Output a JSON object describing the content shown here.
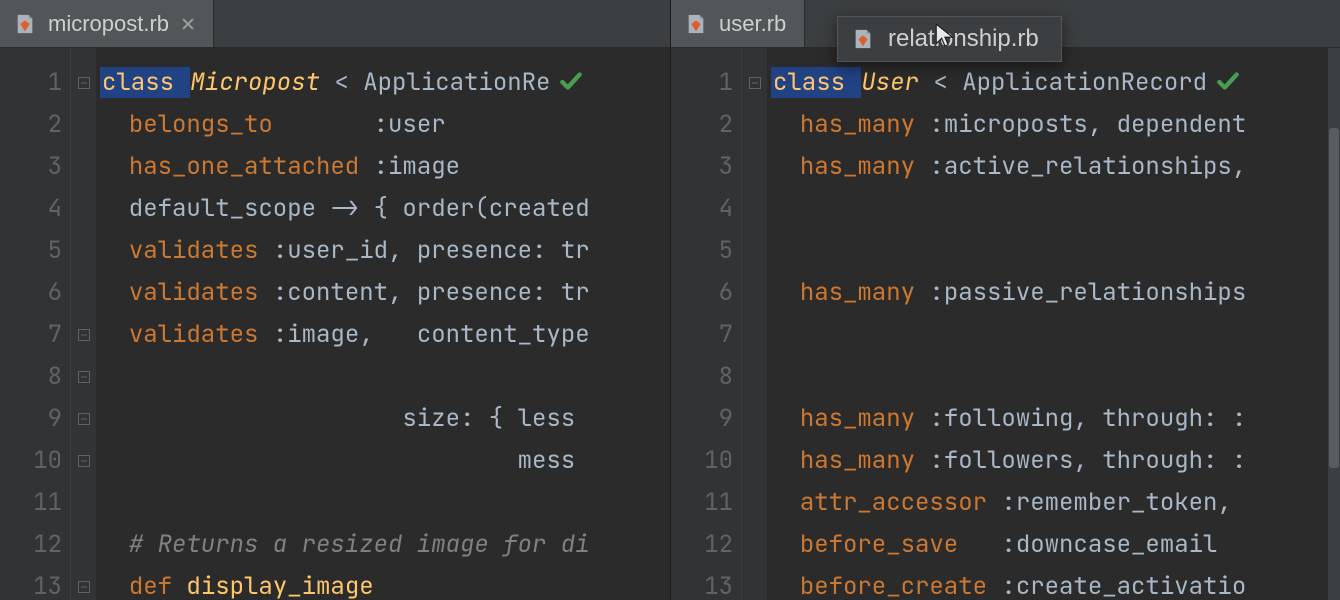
{
  "leftPane": {
    "tab": {
      "label": "micropost.rb"
    },
    "lines": [
      1,
      2,
      3,
      4,
      5,
      6,
      7,
      8,
      9,
      10,
      11,
      12,
      13
    ],
    "fold": {
      "1": true,
      "7": true,
      "8": true,
      "9": true,
      "10": true,
      "13": true
    },
    "code": [
      {
        "segments": [
          {
            "t": "class ",
            "c": "hl-class tok-key"
          },
          {
            "t": "Micropost",
            "c": "tok-class"
          },
          {
            "t": " < ",
            "c": "tok-ident"
          },
          {
            "t": "ApplicationRe",
            "c": "tok-classref"
          },
          {
            "check": true
          }
        ]
      },
      {
        "segments": [
          {
            "t": "  ",
            "c": ""
          },
          {
            "t": "belongs_to",
            "c": "tok-key"
          },
          {
            "t": "       ",
            "c": ""
          },
          {
            "t": ":user",
            "c": "tok-sym"
          }
        ]
      },
      {
        "segments": [
          {
            "t": "  ",
            "c": ""
          },
          {
            "t": "has_one_attached",
            "c": "tok-key"
          },
          {
            "t": " ",
            "c": ""
          },
          {
            "t": ":image",
            "c": "tok-sym"
          }
        ]
      },
      {
        "segments": [
          {
            "t": "  default_scope -> { order(created",
            "c": "tok-ident"
          }
        ]
      },
      {
        "segments": [
          {
            "t": "  ",
            "c": ""
          },
          {
            "t": "validates",
            "c": "tok-key"
          },
          {
            "t": " :user_id, presence: tr",
            "c": "tok-ident"
          }
        ]
      },
      {
        "segments": [
          {
            "t": "  ",
            "c": ""
          },
          {
            "t": "validates",
            "c": "tok-key"
          },
          {
            "t": " :content, presence: tr",
            "c": "tok-ident"
          }
        ]
      },
      {
        "segments": [
          {
            "t": "  ",
            "c": ""
          },
          {
            "t": "validates",
            "c": "tok-key"
          },
          {
            "t": " :image,   content_type",
            "c": "tok-ident"
          }
        ]
      },
      {
        "segments": [
          {
            "t": " ",
            "c": ""
          }
        ]
      },
      {
        "segments": [
          {
            "t": "                     size: { less",
            "c": "tok-ident"
          }
        ]
      },
      {
        "segments": [
          {
            "t": "                             mess",
            "c": "tok-ident"
          }
        ]
      },
      {
        "segments": [
          {
            "t": " ",
            "c": ""
          }
        ]
      },
      {
        "segments": [
          {
            "t": "  ",
            "c": ""
          },
          {
            "t": "# Returns a resized image for di",
            "c": "tok-comment"
          }
        ]
      },
      {
        "segments": [
          {
            "t": "  ",
            "c": ""
          },
          {
            "t": "def",
            "c": "tok-def"
          },
          {
            "t": " ",
            "c": ""
          },
          {
            "t": "display_image",
            "c": "tok-method"
          }
        ]
      }
    ]
  },
  "rightPane": {
    "tab": {
      "label": "user.rb"
    },
    "dragTab": {
      "label": "relationship.rb"
    },
    "lines": [
      1,
      2,
      3,
      4,
      5,
      6,
      7,
      8,
      9,
      10,
      11,
      12,
      13
    ],
    "fold": {
      "1": true
    },
    "code": [
      {
        "segments": [
          {
            "t": "class ",
            "c": "hl-class tok-key"
          },
          {
            "t": "User",
            "c": "tok-class"
          },
          {
            "t": " < ",
            "c": "tok-ident"
          },
          {
            "t": "ApplicationRecord",
            "c": "tok-classref"
          },
          {
            "check": true
          }
        ]
      },
      {
        "segments": [
          {
            "t": "  ",
            "c": ""
          },
          {
            "t": "has_many",
            "c": "tok-key"
          },
          {
            "t": " :microposts, dependent",
            "c": "tok-ident"
          }
        ]
      },
      {
        "segments": [
          {
            "t": "  ",
            "c": ""
          },
          {
            "t": "has_many",
            "c": "tok-key"
          },
          {
            "t": " :active_relationships,",
            "c": "tok-ident"
          }
        ]
      },
      {
        "segments": [
          {
            "t": " ",
            "c": ""
          }
        ]
      },
      {
        "segments": [
          {
            "t": " ",
            "c": ""
          }
        ]
      },
      {
        "segments": [
          {
            "t": "  ",
            "c": ""
          },
          {
            "t": "has_many",
            "c": "tok-key"
          },
          {
            "t": " :passive_relationships",
            "c": "tok-ident"
          }
        ]
      },
      {
        "segments": [
          {
            "t": " ",
            "c": ""
          }
        ]
      },
      {
        "segments": [
          {
            "t": " ",
            "c": ""
          }
        ]
      },
      {
        "segments": [
          {
            "t": "  ",
            "c": ""
          },
          {
            "t": "has_many",
            "c": "tok-key"
          },
          {
            "t": " :following, through: :",
            "c": "tok-ident"
          }
        ]
      },
      {
        "segments": [
          {
            "t": "  ",
            "c": ""
          },
          {
            "t": "has_many",
            "c": "tok-key"
          },
          {
            "t": " :followers, through: :",
            "c": "tok-ident"
          }
        ]
      },
      {
        "segments": [
          {
            "t": "  ",
            "c": ""
          },
          {
            "t": "attr_accessor",
            "c": "tok-key"
          },
          {
            "t": " :remember_token,",
            "c": "tok-ident"
          }
        ]
      },
      {
        "segments": [
          {
            "t": "  ",
            "c": ""
          },
          {
            "t": "before_save",
            "c": "tok-key"
          },
          {
            "t": "   :downcase_email",
            "c": "tok-ident"
          }
        ]
      },
      {
        "segments": [
          {
            "t": "  ",
            "c": ""
          },
          {
            "t": "before_create",
            "c": "tok-key"
          },
          {
            "t": " :create_activatio",
            "c": "tok-ident"
          }
        ]
      }
    ]
  }
}
